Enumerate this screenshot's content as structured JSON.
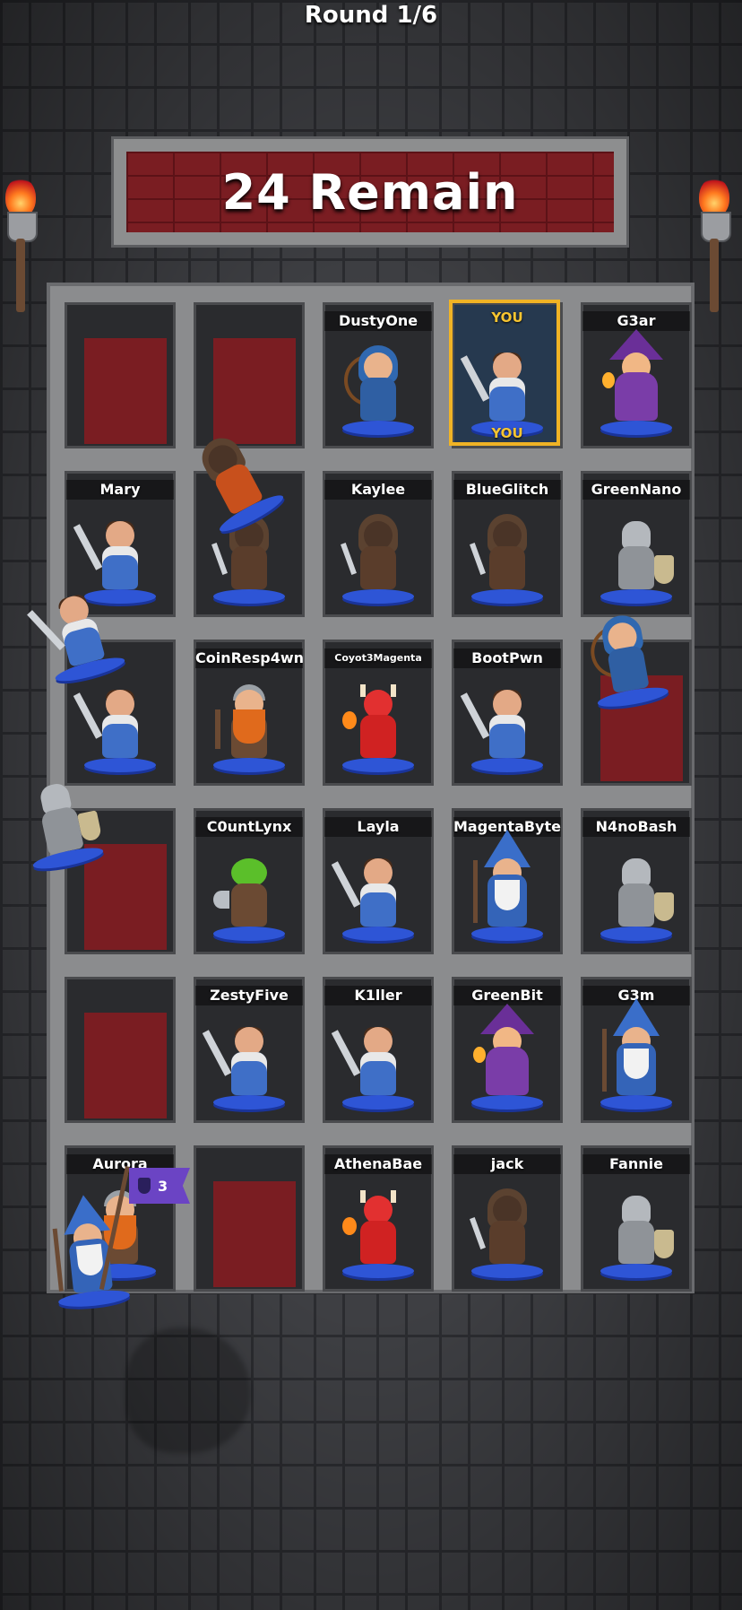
{
  "header": {
    "round_label": "Round 1/6"
  },
  "banner": {
    "remaining_label": "24 Remain"
  },
  "you_cell": {
    "top_label": "YOU",
    "bottom_label": "YOU"
  },
  "flag": {
    "count": "3"
  },
  "grid": {
    "rows": [
      [
        {
          "name": "",
          "state": "empty"
        },
        {
          "name": "",
          "state": "empty"
        },
        {
          "name": "DustyOne",
          "type": "archer"
        },
        {
          "name": "",
          "type": "knight",
          "you": true
        },
        {
          "name": "G3ar",
          "type": "witch"
        }
      ],
      [
        {
          "name": "Mary",
          "type": "knight"
        },
        {
          "name": "",
          "type": "rogue"
        },
        {
          "name": "Kaylee",
          "type": "rogue"
        },
        {
          "name": "BlueGlitch",
          "type": "rogue"
        },
        {
          "name": "GreenNano",
          "type": "armor"
        }
      ],
      [
        {
          "name": "",
          "type": "knight"
        },
        {
          "name": "CoinResp4wn",
          "type": "dwarf"
        },
        {
          "name": "Coyot3Magenta",
          "type": "demon",
          "small": true
        },
        {
          "name": "BootPwn",
          "type": "knight"
        },
        {
          "name": "",
          "state": "empty"
        }
      ],
      [
        {
          "name": "",
          "state": "empty"
        },
        {
          "name": "C0untLynx",
          "type": "goblin"
        },
        {
          "name": "Layla",
          "type": "knight"
        },
        {
          "name": "MagentaByte",
          "type": "wizard"
        },
        {
          "name": "N4noBash",
          "type": "armor"
        }
      ],
      [
        {
          "name": "",
          "state": "empty"
        },
        {
          "name": "ZestyFive",
          "type": "knight"
        },
        {
          "name": "K1ller",
          "type": "knight"
        },
        {
          "name": "GreenBit",
          "type": "witch"
        },
        {
          "name": "G3m",
          "type": "wizard"
        }
      ],
      [
        {
          "name": "Aurora",
          "type": "dwarf"
        },
        {
          "name": "",
          "state": "empty"
        },
        {
          "name": "AthenaBae",
          "type": "demon"
        },
        {
          "name": "jack",
          "type": "rogue"
        },
        {
          "name": "Fannie",
          "type": "armor"
        }
      ]
    ]
  }
}
